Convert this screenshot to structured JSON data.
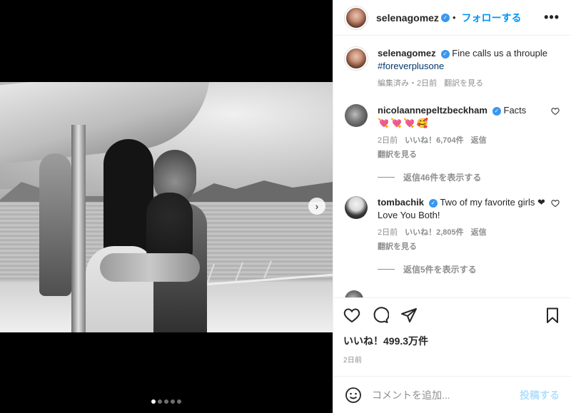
{
  "header": {
    "username": "selenagomez",
    "separator": "•",
    "follow_label": "フォローする",
    "more_label": "•••"
  },
  "caption": {
    "username": "selenagomez",
    "text": "Fine calls us a throuple",
    "hashtag": "#foreverplusone",
    "edited": "編集済み・2日前",
    "translate": "翻訳を見る"
  },
  "comments": [
    {
      "username": "nicolaannepeltzbeckham",
      "text": "Facts",
      "emojis": "💘💘💘🥰",
      "time": "2日前",
      "likes": "いいね！6,704件",
      "reply": "返信",
      "translate": "翻訳を見る",
      "view_replies": "返信46件を表示する"
    },
    {
      "username": "tombachik",
      "text": "Two of my favorite girls ❤ Love You Both!",
      "time": "2日前",
      "likes": "いいね！2,805件",
      "reply": "返信",
      "translate": "翻訳を見る",
      "view_replies": "返信5件を表示する"
    }
  ],
  "post": {
    "likes": "いいね！499.3万件",
    "time": "2日前"
  },
  "composer": {
    "placeholder": "コメントを追加...",
    "post_label": "投稿する"
  },
  "media": {
    "next_icon": "›",
    "slide_count": 5,
    "active_slide": 1
  },
  "colors": {
    "accent": "#0095f6",
    "verified": "#3897f0",
    "post_disabled": "#b2dffc",
    "secondary_text": "#8e8e8e"
  }
}
